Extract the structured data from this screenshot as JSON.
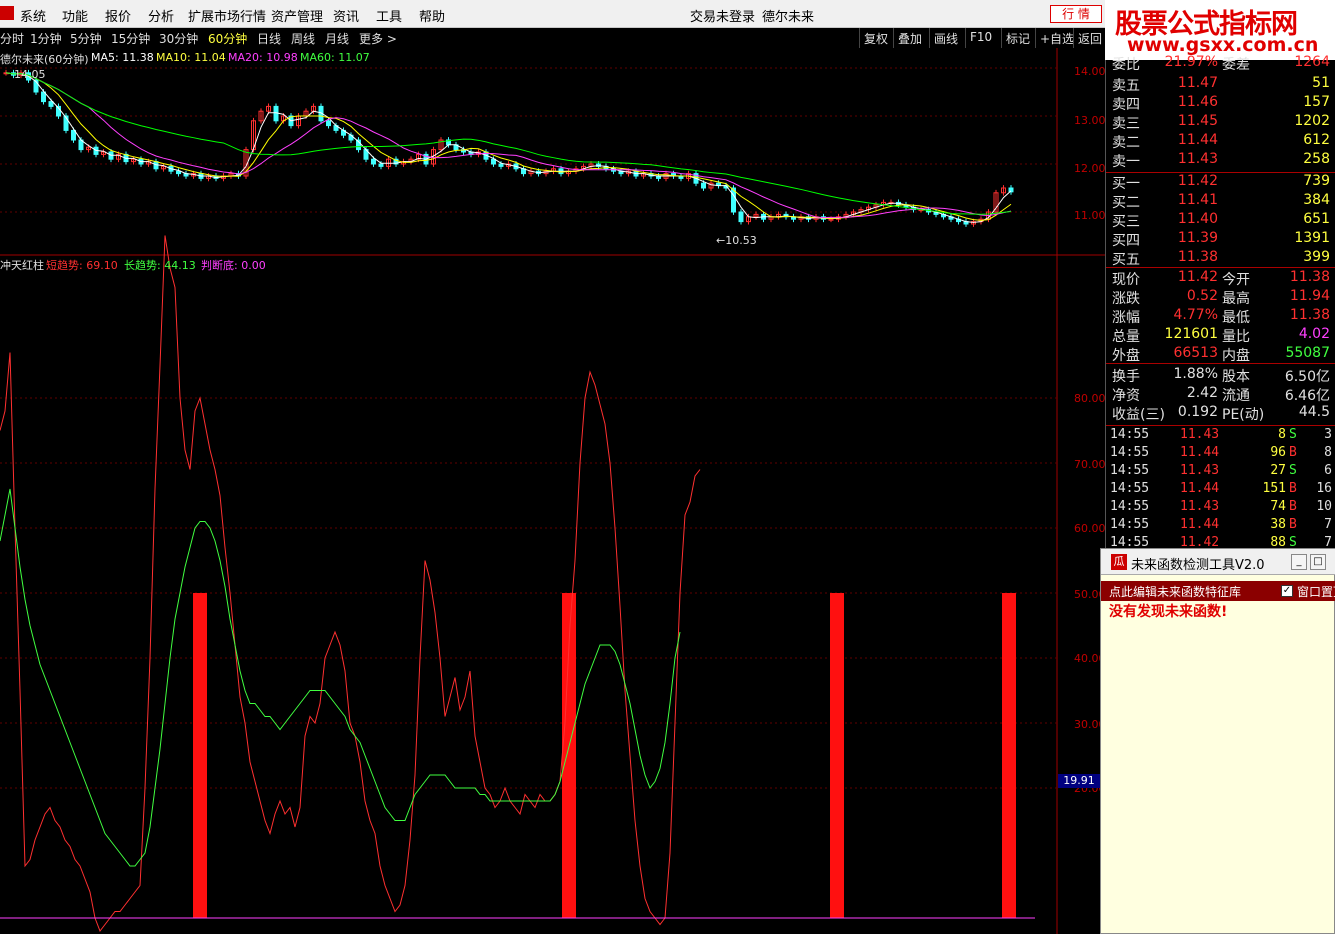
{
  "menu": {
    "items": [
      "系统",
      "功能",
      "报价",
      "分析",
      "扩展市场行情",
      "资产管理",
      "资讯",
      "工具",
      "帮助"
    ],
    "status_login": "交易未登录",
    "status_stock": "德尔未来",
    "quote_button": "行 情"
  },
  "watermark": {
    "line1": "股票公式指标网",
    "line2": "www.gsxx.com.cn"
  },
  "periods": [
    "分时",
    "1分钟",
    "5分钟",
    "15分钟",
    "30分钟",
    "60分钟",
    "日线",
    "周线",
    "月线",
    "更多 >"
  ],
  "active_period": "60分钟",
  "tools": [
    "复权",
    "叠加",
    "画线",
    "F10",
    "标记",
    "+自选",
    "返回"
  ],
  "price_chart": {
    "title": "德尔未来(60分钟)",
    "ma5": "MA5: 11.38",
    "ma10": "MA10: 11.04",
    "ma20": "MA20: 10.98",
    "ma60": "MA60: 11.07",
    "high_label": "14.05",
    "low_label": "←10.53",
    "y_ticks": [
      "14.00",
      "13.00",
      "12.00",
      "11.00"
    ],
    "colors": {
      "ma5": "#ffffff",
      "ma10": "#ffff00",
      "ma20": "#ff40ff",
      "ma60": "#00ff00",
      "up": "#ff3030",
      "down": "#40ffff"
    }
  },
  "indicator": {
    "name": "冲天红柱",
    "short_label": "短趋势: 69.10",
    "long_label": "长趋势: 44.13",
    "judge_label": "判断底: 0.00",
    "y_ticks": [
      "80.00",
      "70.00",
      "60.00",
      "50.00",
      "40.00",
      "30.00",
      "20.00"
    ],
    "current_value": "19.91",
    "colors": {
      "short": "#ff3030",
      "long": "#40ff40",
      "judge": "#ff40ff",
      "bar": "#ff1010"
    }
  },
  "chart_data": {
    "type": "line",
    "x": [
      0,
      5,
      10,
      15,
      20,
      25,
      30,
      35,
      40,
      45,
      50,
      55,
      60,
      65,
      70,
      75,
      80,
      85,
      90,
      95,
      100,
      105,
      110,
      115,
      120,
      125,
      130,
      135,
      140,
      145,
      150,
      155,
      160,
      165,
      170,
      175,
      180,
      185,
      190,
      195,
      200,
      205,
      210,
      215,
      220,
      225,
      230,
      235,
      240,
      245,
      250,
      255,
      260,
      265,
      270,
      275,
      280,
      285,
      290,
      295,
      300,
      305,
      310,
      315,
      320,
      325,
      330,
      335,
      340,
      345,
      350,
      355,
      360,
      365,
      370,
      375,
      380,
      385,
      390,
      395,
      400,
      405,
      410,
      415,
      420,
      425,
      430,
      435,
      440,
      445,
      450,
      455,
      460,
      465,
      470,
      475,
      480,
      485,
      490,
      495,
      500,
      505,
      510,
      515,
      520,
      525,
      530,
      535,
      540,
      545,
      550,
      555,
      560,
      565,
      570,
      575,
      580,
      585,
      590,
      595,
      600,
      605,
      610,
      615,
      620,
      625,
      630,
      635,
      640,
      645,
      650,
      655,
      660,
      665,
      670,
      675,
      680,
      685,
      690,
      695,
      700,
      705,
      710,
      715,
      720,
      725,
      730,
      735,
      740,
      745,
      750,
      755,
      760,
      765,
      770,
      775,
      780,
      785,
      790,
      795,
      800,
      805,
      810,
      815,
      820,
      825,
      830,
      835,
      840,
      845,
      850,
      855,
      860,
      865,
      870,
      875,
      880,
      885,
      890,
      895,
      900,
      905,
      910,
      915,
      920,
      925,
      930,
      935,
      940,
      945,
      950,
      955,
      960,
      965,
      970,
      975,
      980,
      985,
      990,
      995,
      1000,
      1005,
      1010,
      1015,
      1020,
      1025,
      1030,
      1035
    ],
    "series": [
      {
        "name": "短趋势",
        "values": [
          75,
          78,
          87,
          60,
          35,
          8,
          9,
          12,
          14,
          16,
          17,
          15,
          14,
          12,
          11,
          9,
          8,
          6,
          4,
          0,
          -2,
          -1,
          0,
          1,
          1,
          2,
          3,
          4,
          5,
          20,
          40,
          66,
          85,
          105,
          100,
          97,
          80,
          72,
          69,
          78,
          80,
          76,
          72,
          69,
          65,
          57,
          50,
          42,
          34,
          30,
          24,
          21,
          18,
          15,
          13,
          16,
          18,
          16,
          17,
          14,
          17,
          28,
          31,
          30,
          33,
          40,
          42,
          44,
          42,
          38,
          30,
          28,
          24,
          18,
          15,
          13,
          8,
          5,
          3,
          1,
          2,
          5,
          12,
          22,
          40,
          55,
          52,
          47,
          40,
          31,
          34,
          37,
          32,
          34,
          38,
          28,
          24,
          20,
          19,
          17,
          18,
          20,
          18,
          17,
          16,
          19,
          18,
          17,
          19,
          18,
          18,
          19,
          21,
          30,
          45,
          55,
          70,
          80,
          84,
          82,
          79,
          76,
          70,
          60,
          48,
          35,
          25,
          15,
          8,
          3,
          1,
          0,
          -1,
          0,
          10,
          30,
          50,
          62,
          64,
          68,
          69
        ],
        "color": "#ff3030"
      },
      {
        "name": "长趋势",
        "values": [
          58,
          62,
          66,
          60,
          54,
          49,
          45,
          42,
          39,
          37,
          35,
          33,
          31,
          29,
          27,
          25,
          23,
          21,
          19,
          17,
          15,
          13,
          12,
          11,
          10,
          9,
          8,
          8,
          9,
          10,
          14,
          20,
          26,
          33,
          40,
          46,
          50,
          54,
          57,
          60,
          61,
          61,
          60,
          58,
          55,
          51,
          46,
          42,
          38,
          35,
          33,
          33,
          32,
          31,
          31,
          30,
          29,
          30,
          31,
          32,
          33,
          34,
          35,
          35,
          35,
          35,
          34,
          33,
          32,
          31,
          29,
          28,
          27,
          25,
          23,
          21,
          19,
          17,
          16,
          15,
          15,
          15,
          17,
          19,
          20,
          21,
          22,
          22,
          22,
          22,
          21,
          20,
          20,
          20,
          20,
          20,
          19,
          19,
          18,
          18,
          18,
          18,
          18,
          18,
          18,
          18,
          18,
          18,
          18,
          18,
          18,
          19,
          21,
          24,
          27,
          30,
          33,
          36,
          38,
          40,
          42,
          42,
          42,
          41,
          39,
          36,
          33,
          29,
          25,
          22,
          20,
          21,
          23,
          27,
          33,
          40,
          44
        ],
        "color": "#40ff40"
      },
      {
        "name": "判断底",
        "values": [
          0
        ],
        "color": "#ff40ff"
      }
    ],
    "bars": [
      {
        "x": 200,
        "value": 50
      },
      {
        "x": 569,
        "value": 50
      },
      {
        "x": 837,
        "value": 50
      },
      {
        "x": 1009,
        "value": 50
      }
    ],
    "ylim": [
      0,
      100
    ]
  },
  "price_data": {
    "candles_x_step": 6,
    "closes": [
      13.9,
      13.85,
      13.9,
      13.75,
      13.5,
      13.3,
      13.2,
      13.0,
      12.7,
      12.5,
      12.3,
      12.35,
      12.2,
      12.25,
      12.1,
      12.2,
      12.05,
      12.1,
      12.0,
      12.05,
      11.9,
      11.95,
      11.85,
      11.8,
      11.75,
      11.8,
      11.7,
      11.75,
      11.7,
      11.75,
      11.8,
      11.75,
      12.3,
      12.9,
      13.1,
      13.2,
      12.9,
      13.0,
      12.8,
      13.0,
      13.1,
      13.2,
      12.9,
      12.8,
      12.7,
      12.6,
      12.5,
      12.3,
      12.1,
      12.0,
      11.95,
      12.1,
      12.0,
      12.05,
      12.1,
      12.2,
      12.0,
      12.3,
      12.5,
      12.4,
      12.3,
      12.25,
      12.2,
      12.25,
      12.1,
      12.0,
      11.95,
      12.0,
      11.9,
      11.8,
      11.85,
      11.8,
      11.85,
      11.9,
      11.8,
      11.85,
      11.9,
      11.95,
      12.0,
      11.95,
      11.9,
      11.85,
      11.8,
      11.85,
      11.75,
      11.8,
      11.75,
      11.7,
      11.8,
      11.75,
      11.7,
      11.8,
      11.6,
      11.5,
      11.6,
      11.55,
      11.5,
      11.0,
      10.8,
      10.9,
      10.95,
      10.85,
      10.9,
      10.95,
      10.9,
      10.85,
      10.9,
      10.85,
      10.9,
      10.85,
      10.85,
      10.9,
      10.95,
      11.0,
      11.05,
      11.1,
      11.15,
      11.2,
      11.2,
      11.15,
      11.1,
      11.05,
      11.05,
      11.0,
      10.95,
      10.9,
      10.85,
      10.8,
      10.75,
      10.8,
      10.85,
      11.0,
      11.4,
      11.5,
      11.42
    ],
    "ylim": [
      10.4,
      14.2
    ]
  },
  "quote": {
    "top_row": {
      "label": "委比",
      "val": "21.97%",
      "label2": "委差",
      "val2": "1264"
    },
    "asks": [
      {
        "label": "卖五",
        "price": "11.47",
        "vol": "51"
      },
      {
        "label": "卖四",
        "price": "11.46",
        "vol": "157"
      },
      {
        "label": "卖三",
        "price": "11.45",
        "vol": "1202"
      },
      {
        "label": "卖二",
        "price": "11.44",
        "vol": "612"
      },
      {
        "label": "卖一",
        "price": "11.43",
        "vol": "258"
      }
    ],
    "bids": [
      {
        "label": "买一",
        "price": "11.42",
        "vol": "739"
      },
      {
        "label": "买二",
        "price": "11.41",
        "vol": "384"
      },
      {
        "label": "买三",
        "price": "11.40",
        "vol": "651"
      },
      {
        "label": "买四",
        "price": "11.39",
        "vol": "1391"
      },
      {
        "label": "买五",
        "price": "11.38",
        "vol": "399"
      }
    ],
    "stats": [
      {
        "l1": "现价",
        "v1": "11.42",
        "c1": "#ff3030",
        "l2": "今开",
        "v2": "11.38",
        "c2": "#ff3030"
      },
      {
        "l1": "涨跌",
        "v1": "0.52",
        "c1": "#ff3030",
        "l2": "最高",
        "v2": "11.94",
        "c2": "#ff3030"
      },
      {
        "l1": "涨幅",
        "v1": "4.77%",
        "c1": "#ff3030",
        "l2": "最低",
        "v2": "11.38",
        "c2": "#ff3030"
      },
      {
        "l1": "总量",
        "v1": "121601",
        "c1": "#ffff40",
        "l2": "量比",
        "v2": "4.02",
        "c2": "#ff40ff"
      },
      {
        "l1": "外盘",
        "v1": "66513",
        "c1": "#ff3030",
        "l2": "内盘",
        "v2": "55087",
        "c2": "#40ff40"
      }
    ],
    "stats2": [
      {
        "l1": "换手",
        "v1": "1.88%",
        "l2": "股本",
        "v2": "6.50亿"
      },
      {
        "l1": "净资",
        "v1": "2.42",
        "l2": "流通",
        "v2": "6.46亿"
      },
      {
        "l1": "收益(三)",
        "v1": "0.192",
        "l2": "PE(动)",
        "v2": "44.5"
      }
    ],
    "ticks": [
      {
        "time": "14:55",
        "price": "11.43",
        "vol": "8",
        "side": "S",
        "n": "3"
      },
      {
        "time": "14:55",
        "price": "11.44",
        "vol": "96",
        "side": "B",
        "n": "8"
      },
      {
        "time": "14:55",
        "price": "11.43",
        "vol": "27",
        "side": "S",
        "n": "6"
      },
      {
        "time": "14:55",
        "price": "11.44",
        "vol": "151",
        "side": "B",
        "n": "16"
      },
      {
        "time": "14:55",
        "price": "11.43",
        "vol": "74",
        "side": "B",
        "n": "10"
      },
      {
        "time": "14:55",
        "price": "11.44",
        "vol": "38",
        "side": "B",
        "n": "7"
      },
      {
        "time": "14:55",
        "price": "11.42",
        "vol": "88",
        "side": "S",
        "n": "7"
      }
    ]
  },
  "tool_window": {
    "title": "未来函数检测工具V2.0",
    "icon": "瓜",
    "edit_link": "点此编辑未来函数特征库",
    "pin_label": "窗口置顶",
    "message": "没有发现未来函数!"
  }
}
